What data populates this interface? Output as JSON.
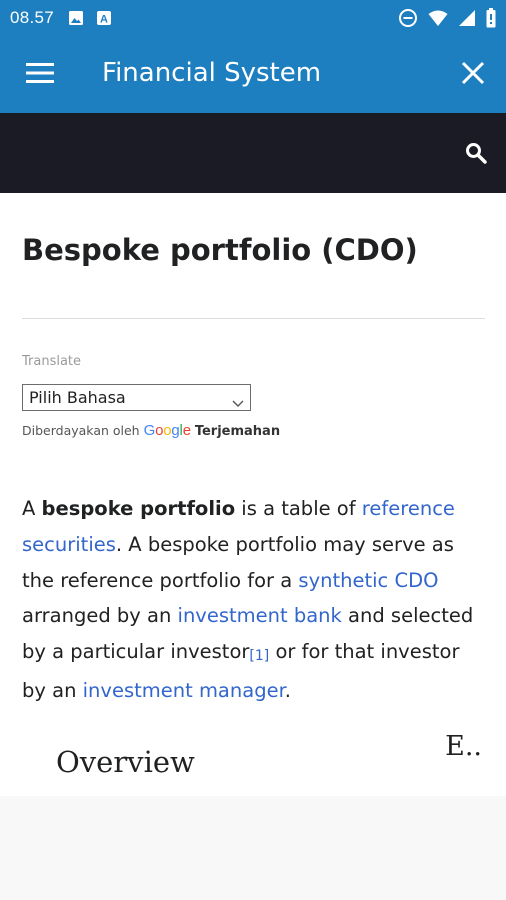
{
  "status_bar": {
    "time": "08.57",
    "left_icons": [
      "image-icon",
      "a-notification-icon"
    ],
    "right_icons": [
      "do-not-disturb-icon",
      "wifi-icon",
      "signal-icon",
      "battery-icon"
    ]
  },
  "app_bar": {
    "title": "Financial System",
    "menu_icon": "hamburger-menu-icon",
    "close_icon": "close-icon",
    "color": "#1e7fc0"
  },
  "search_bar": {
    "search_icon": "search-icon",
    "color": "#1b1b26"
  },
  "article": {
    "title": "Bespoke portfolio (CDO)",
    "translate": {
      "label": "Translate",
      "select_value": "Pilih Bahasa",
      "powered_by": "Diberdayakan oleh",
      "google_letters": [
        "G",
        "o",
        "o",
        "g",
        "l",
        "e"
      ],
      "translate_link": "Terjemahan"
    },
    "paragraph": {
      "t1": "A ",
      "bold": "bespoke portfolio",
      "t2": " is a table of ",
      "link1": "reference securities",
      "t3": ". A bespoke portfolio may serve as the reference portfolio for a ",
      "link2": "synthetic CDO",
      "t4": " arranged by an ",
      "link3": "investment bank",
      "t5": " and selected by a particular investor",
      "ref": "[1]",
      "t6": " or for that investor by an ",
      "link4": "investment manager",
      "t7": "."
    },
    "section_heading": "Overview",
    "edit_truncated": "E..",
    "link_color": "#3366cc"
  }
}
